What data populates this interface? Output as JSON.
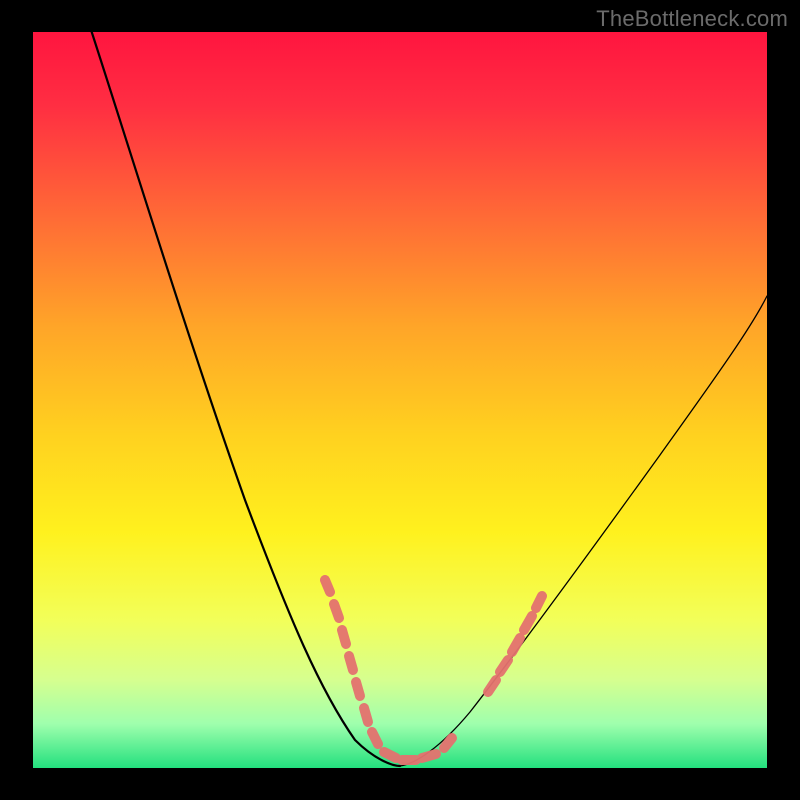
{
  "watermark": "TheBottleneck.com",
  "chart_data": {
    "type": "line",
    "title": "",
    "xlabel": "",
    "ylabel": "",
    "xlim": [
      0,
      100
    ],
    "ylim": [
      0,
      100
    ],
    "grid": false,
    "legend": false,
    "gradient": {
      "top": "#ff1a46",
      "upper_mid": "#ff9a1f",
      "mid": "#ffe822",
      "lower_mid": "#f4ff7a",
      "bottom": "#1fe07a"
    },
    "series": [
      {
        "name": "curve-left",
        "stroke": "#000000",
        "stroke_width": 2,
        "x": [
          8,
          12,
          16,
          20,
          24,
          28,
          32,
          36,
          40,
          42,
          44,
          46,
          48,
          50
        ],
        "y": [
          100,
          90,
          80,
          70,
          60,
          50,
          40,
          30,
          20,
          15,
          10,
          6,
          3,
          1
        ]
      },
      {
        "name": "curve-right",
        "stroke": "#000000",
        "stroke_width": 1.2,
        "x": [
          50,
          54,
          58,
          62,
          66,
          70,
          74,
          78,
          82,
          86,
          90,
          94,
          98,
          100
        ],
        "y": [
          1,
          3,
          7,
          12,
          18,
          24,
          30,
          36,
          42,
          48,
          53,
          58,
          63,
          66
        ]
      },
      {
        "name": "marker-cluster",
        "type": "scatter",
        "color": "#e66a6a",
        "x": [
          40,
          41,
          42,
          43,
          45,
          47,
          48,
          50,
          52,
          54,
          56,
          60,
          62,
          64,
          66
        ],
        "y": [
          25,
          22,
          18,
          16,
          10,
          6,
          4,
          2,
          2,
          3,
          4,
          9,
          13,
          18,
          22
        ]
      }
    ]
  }
}
